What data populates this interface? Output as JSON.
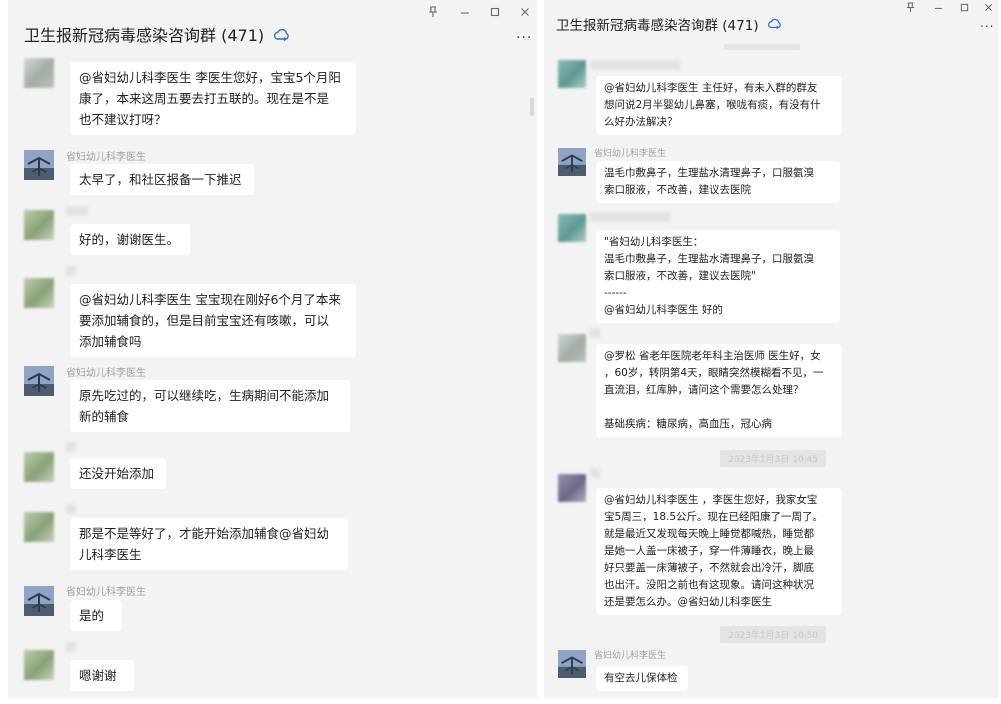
{
  "left": {
    "title": "卫生报新冠病毒感染咨询群 (471)",
    "more": "...",
    "messages": [
      {
        "sender": "",
        "text": "@省妇幼儿科李医生 李医生您好，宝宝5个月阳\n康了，本来这周五要去打五联的。现在是不是\n也不建议打呀？"
      },
      {
        "sender": "省妇幼儿科李医生",
        "text": "太早了，和社区报备一下推迟"
      },
      {
        "sender": "",
        "text": "好的，谢谢医生。"
      },
      {
        "sender": "",
        "text": "@省妇幼儿科李医生 宝宝现在刚好6个月了本来\n要添加辅食的，但是目前宝宝还有咳嗽，可以\n添加辅食吗"
      },
      {
        "sender": "省妇幼儿科李医生",
        "text": "原先吃过的，可以继续吃，生病期间不能添加\n新的辅食"
      },
      {
        "sender": "",
        "text": "还没开始添加"
      },
      {
        "sender": "",
        "text": "那是不是等好了，才能开始添加辅食@省妇幼\n儿科李医生"
      },
      {
        "sender": "省妇幼儿科李医生",
        "text": "是的"
      },
      {
        "sender": "",
        "text": "嗯谢谢"
      }
    ]
  },
  "right": {
    "title": "卫生报新冠病毒感染咨询群 (471)",
    "more": "...",
    "messages": [
      {
        "sender": "",
        "text": "@省妇幼儿科李医生 主任好，有未入群的群友\n想问说2月半婴幼儿鼻塞，喉咙有痰，有没有什\n么好办法解决？"
      },
      {
        "sender": "省妇幼儿科李医生",
        "text": "温毛巾敷鼻子，生理盐水清理鼻子，口服氨溴\n索口服液，不改善，建议去医院"
      },
      {
        "sender": "",
        "text": "\"省妇幼儿科李医生：\n温毛巾敷鼻子，生理盐水清理鼻子，口服氨溴\n索口服液，不改善，建议去医院\"\n------\n@省妇幼儿科李医生 好的"
      },
      {
        "sender": "",
        "text": "@罗松 省老年医院老年科主治医师 医生好，女\n，60岁，转阴第4天，眼睛突然模糊看不见，一\n直流泪，红库肿，请问这个需要怎么处理？\n\n基础疾病：糖尿病，高血压，冠心病"
      },
      {
        "sender": "",
        "text": "@省妇幼儿科李医生 ，李医生您好，我家女宝\n宝5周三，18.5公斤。现在已经阳康了一周了。\n就是最近又发现每天晚上睡觉都喊热，睡觉都\n是她一人盖一床被子，穿一件薄睡衣，晚上最\n好只要盖一床薄被子，不然就会出冷汗，脚底\n也出汗。没阳之前也有这现象。请问这种状况\n还是要怎么办。@省妇幼儿科李医生"
      },
      {
        "sender": "省妇幼儿科李医生",
        "text": "有空去儿保体检"
      }
    ],
    "timestamps": [
      "2023年1月3日 10:45",
      "2023年1月3日 10:50"
    ]
  },
  "icons": [
    "pin-icon",
    "minimize-icon",
    "maximize-icon",
    "close-icon",
    "cloud-sync-icon",
    "more-icon",
    "doctor-avatar",
    "blurred-avatar"
  ]
}
